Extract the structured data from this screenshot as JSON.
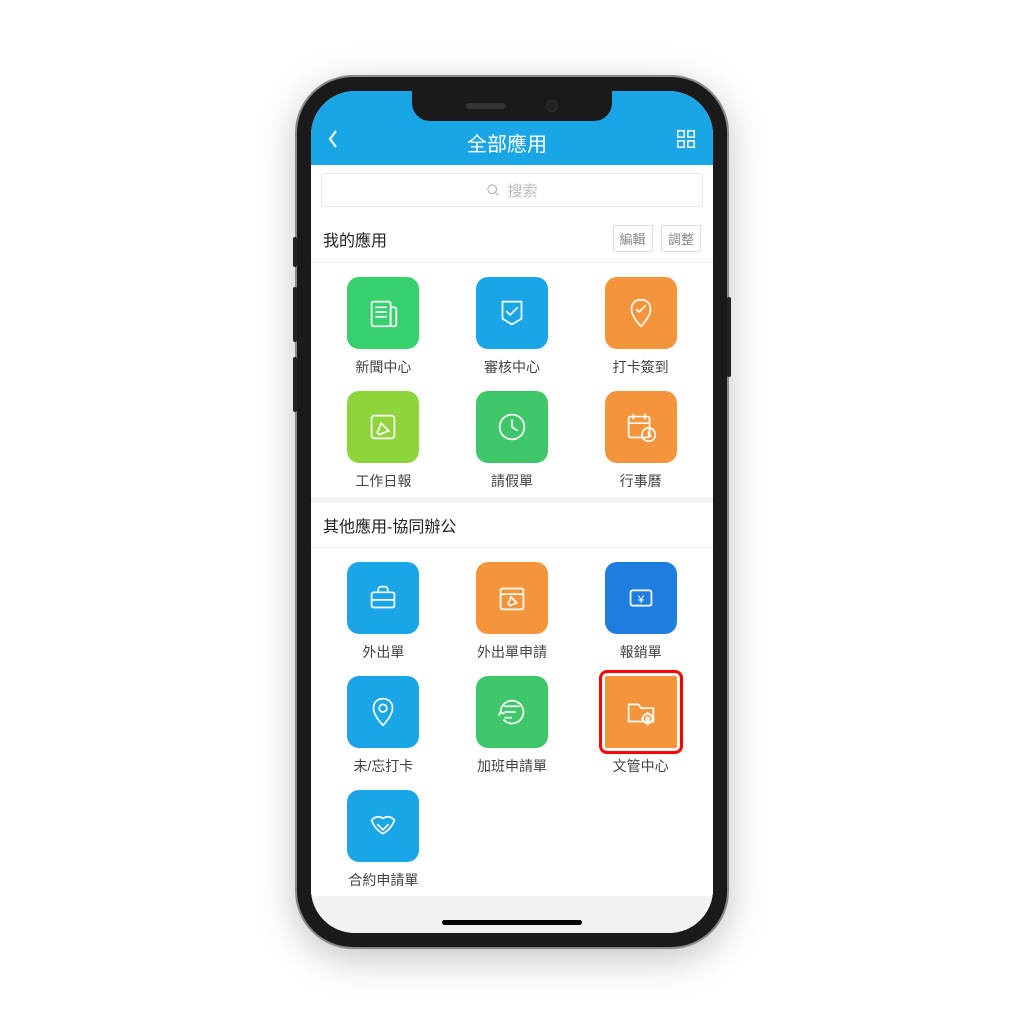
{
  "header": {
    "title": "全部應用"
  },
  "search": {
    "placeholder": "搜索"
  },
  "sections": {
    "mine": {
      "title": "我的應用",
      "actions": {
        "edit": "編輯",
        "adjust": "調整"
      },
      "apps": [
        {
          "label": "新聞中心",
          "icon": "newspaper-icon",
          "color": "c-green1"
        },
        {
          "label": "審核中心",
          "icon": "check-shield-icon",
          "color": "c-blue1"
        },
        {
          "label": "打卡簽到",
          "icon": "location-check-icon",
          "color": "c-orange"
        },
        {
          "label": "工作日報",
          "icon": "edit-note-icon",
          "color": "c-green2"
        },
        {
          "label": "請假單",
          "icon": "clock-icon",
          "color": "c-green3"
        },
        {
          "label": "行事曆",
          "icon": "calendar-clock-icon",
          "color": "c-orange"
        }
      ]
    },
    "other": {
      "title": "其他應用-協同辦公",
      "apps": [
        {
          "label": "外出單",
          "icon": "briefcase-icon",
          "color": "c-blue1"
        },
        {
          "label": "外出單申請",
          "icon": "calendar-edit-icon",
          "color": "c-orange"
        },
        {
          "label": "報銷單",
          "icon": "yen-receipt-icon",
          "color": "c-blue2"
        },
        {
          "label": "未/忘打卡",
          "icon": "location-pin-icon",
          "color": "c-blue1"
        },
        {
          "label": "加班申請單",
          "icon": "history-icon",
          "color": "c-green3"
        },
        {
          "label": "文管中心",
          "icon": "folder-gear-icon",
          "color": "c-orange",
          "highlight": true
        },
        {
          "label": "合約申請單",
          "icon": "handshake-icon",
          "color": "c-blue1"
        }
      ]
    }
  }
}
